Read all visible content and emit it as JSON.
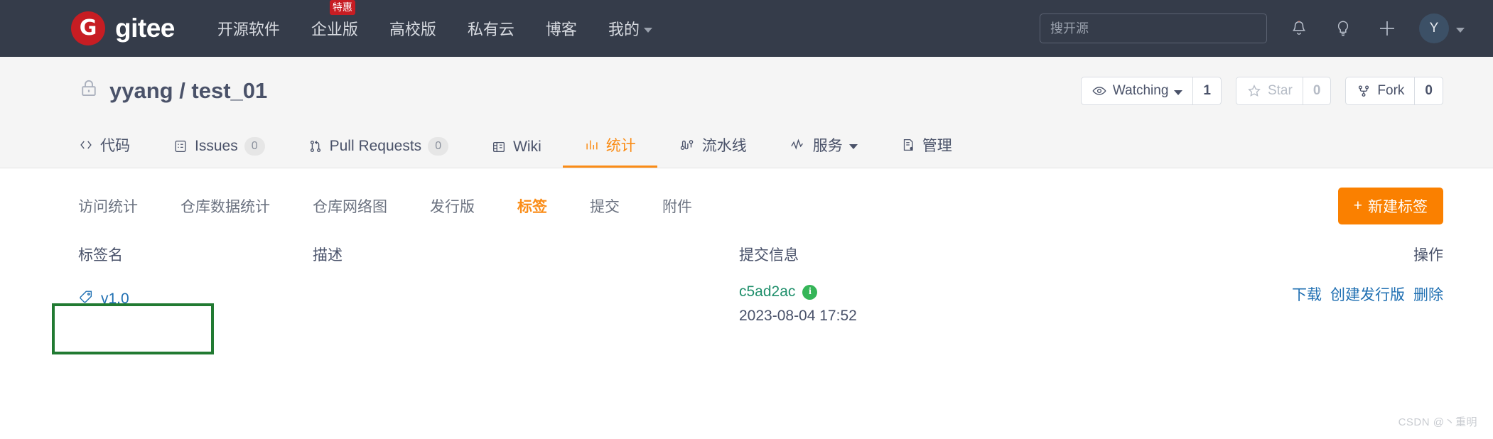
{
  "topbar": {
    "logo_letter": "G",
    "logo_text": "gitee",
    "nav": [
      {
        "label": "开源软件",
        "badge": null,
        "caret": false,
        "name": "nav-open-source"
      },
      {
        "label": "企业版",
        "badge": "特惠",
        "caret": false,
        "name": "nav-enterprise"
      },
      {
        "label": "高校版",
        "badge": null,
        "caret": false,
        "name": "nav-education"
      },
      {
        "label": "私有云",
        "badge": null,
        "caret": false,
        "name": "nav-private-cloud"
      },
      {
        "label": "博客",
        "badge": null,
        "caret": false,
        "name": "nav-blog"
      },
      {
        "label": "我的",
        "badge": null,
        "caret": true,
        "name": "nav-mine"
      }
    ],
    "search_placeholder": "搜开源",
    "search_value": "",
    "icons": [
      "bell-icon",
      "lightbulb-icon",
      "plus-icon"
    ],
    "avatar_letter": "Y"
  },
  "repo": {
    "owner": "yyang",
    "separator": "/",
    "name": "test_01",
    "full_title": "yyang / test_01",
    "visibility_icon": "lock-icon",
    "watch": {
      "label": "Watching",
      "count": "1"
    },
    "star": {
      "label": "Star",
      "count": "0"
    },
    "fork": {
      "label": "Fork",
      "count": "0"
    },
    "tabs": [
      {
        "label": "代码",
        "icon": "code-icon",
        "count": null,
        "active": false,
        "caret": false,
        "name": "tab-code"
      },
      {
        "label": "Issues",
        "icon": "issue-icon",
        "count": "0",
        "active": false,
        "caret": false,
        "name": "tab-issues"
      },
      {
        "label": "Pull Requests",
        "icon": "pull-request-icon",
        "count": "0",
        "active": false,
        "caret": false,
        "name": "tab-pull-requests"
      },
      {
        "label": "Wiki",
        "icon": "book-icon",
        "count": null,
        "active": false,
        "caret": false,
        "name": "tab-wiki"
      },
      {
        "label": "统计",
        "icon": "chart-icon",
        "count": null,
        "active": true,
        "caret": false,
        "name": "tab-statistics"
      },
      {
        "label": "流水线",
        "icon": "pipeline-icon",
        "count": null,
        "active": false,
        "caret": false,
        "name": "tab-pipeline"
      },
      {
        "label": "服务",
        "icon": "activity-icon",
        "count": null,
        "active": false,
        "caret": true,
        "name": "tab-services"
      },
      {
        "label": "管理",
        "icon": "settings-doc-icon",
        "count": null,
        "active": false,
        "caret": false,
        "name": "tab-manage"
      }
    ]
  },
  "subnav": {
    "items": [
      {
        "label": "访问统计",
        "active": false,
        "name": "subnav-visits"
      },
      {
        "label": "仓库数据统计",
        "active": false,
        "name": "subnav-repo-data"
      },
      {
        "label": "仓库网络图",
        "active": false,
        "name": "subnav-network-graph"
      },
      {
        "label": "发行版",
        "active": false,
        "name": "subnav-releases"
      },
      {
        "label": "标签",
        "active": true,
        "name": "subnav-tags"
      },
      {
        "label": "提交",
        "active": false,
        "name": "subnav-commits"
      },
      {
        "label": "附件",
        "active": false,
        "name": "subnav-attachments"
      }
    ],
    "new_tag_button": "新建标签",
    "new_tag_plus": "+"
  },
  "table": {
    "headers": {
      "name": "标签名",
      "description": "描述",
      "commit": "提交信息",
      "operations": "操作"
    },
    "rows": [
      {
        "tag_name": "v1.0",
        "tag_icon": "tag-icon",
        "description": "",
        "commit_sha": "c5ad2ac",
        "commit_info_badge": "i",
        "commit_date": "2023-08-04 17:52",
        "operations": [
          "下载",
          "创建发行版",
          "删除"
        ]
      }
    ]
  },
  "watermark": "CSDN @丶重明",
  "colors": {
    "navbar_bg": "#353c4a",
    "accent_orange": "#fa8c16",
    "button_orange": "#fa8000",
    "logo_red": "#c71d23",
    "link_blue": "#1f6fb2",
    "commit_green": "#1f8f6b",
    "annotation_green": "#217a32"
  }
}
